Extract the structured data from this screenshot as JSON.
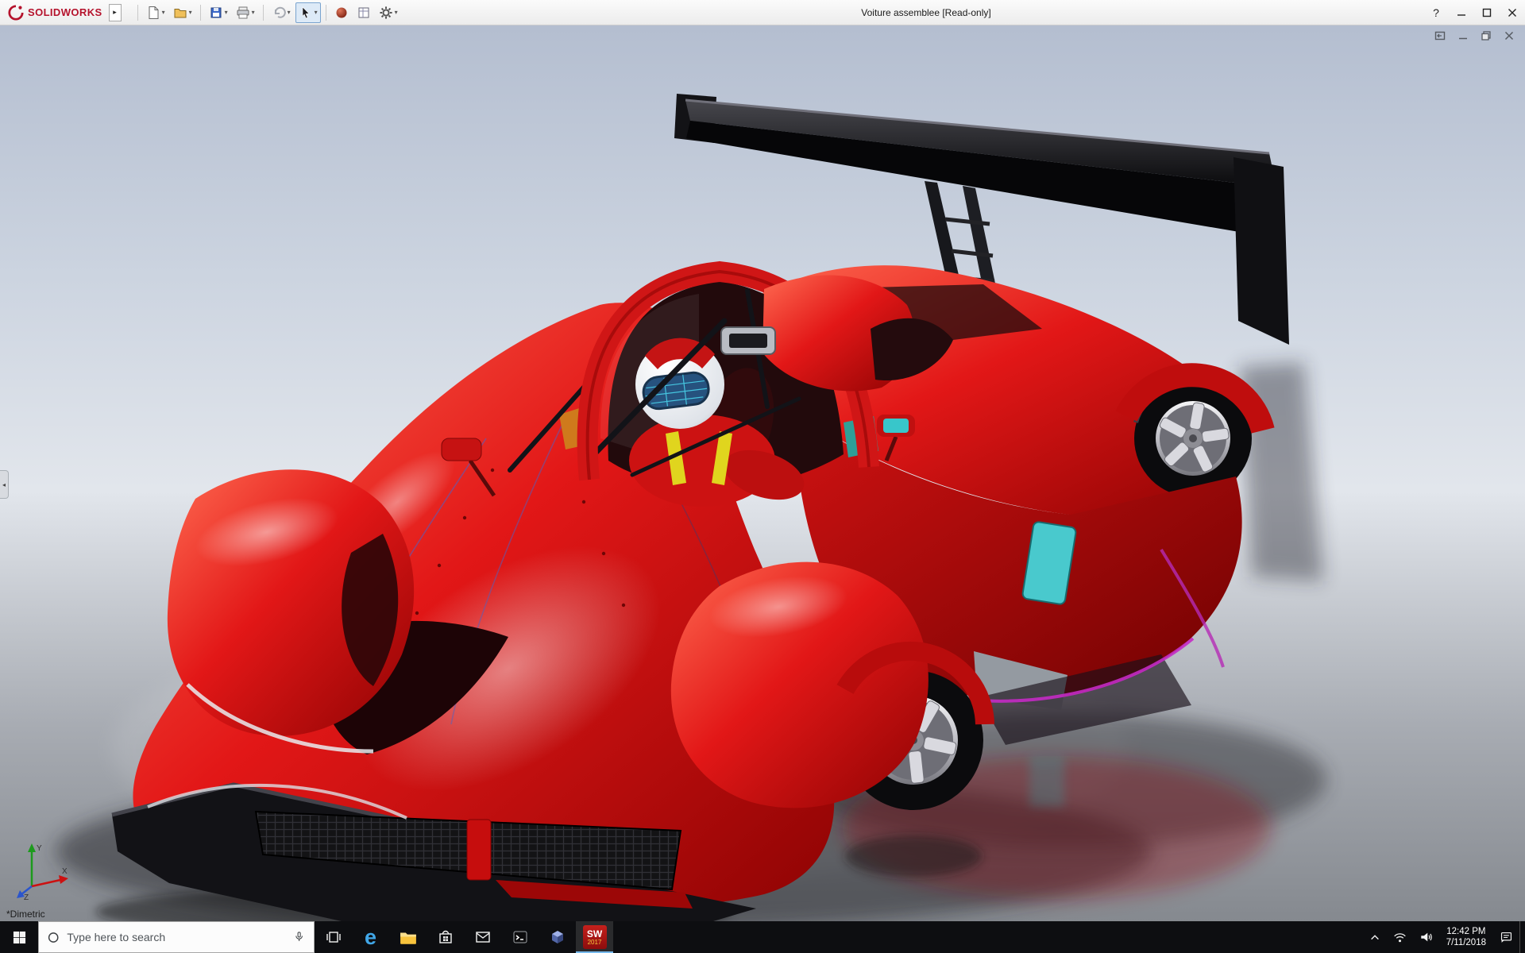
{
  "colors": {
    "titlebar_bg": "#f2f2f2",
    "taskbar_bg": "#0d0e11",
    "brand_red": "#b5122c",
    "car_red": "#e21717",
    "wing_black": "#0a0a0c",
    "viewport_sky": "#c7cfdd",
    "viewport_floor": "#85898f",
    "window_teal": "#49c9cd",
    "trim_magenta": "#c42ac4"
  },
  "window": {
    "brand": "SOLIDWORKS",
    "title": "Voiture assemblee [Read-only]",
    "help_label": "?"
  },
  "toolbar": {
    "items": [
      {
        "name": "new-document"
      },
      {
        "name": "open-document"
      },
      {
        "name": "save"
      },
      {
        "name": "print"
      },
      {
        "name": "undo"
      },
      {
        "name": "select-tool",
        "active": true
      },
      {
        "name": "appearance-sphere"
      },
      {
        "name": "sheet-properties"
      },
      {
        "name": "options-gear"
      }
    ]
  },
  "viewport": {
    "view_label": "*Dimetric",
    "triad": {
      "x_label": "X",
      "y_label": "Y",
      "z_label": "Z"
    },
    "scene_description": "red prototype race car assembly with driver, rear wing and open wheels on reflective floor"
  },
  "taskbar": {
    "search": {
      "placeholder": "Type here to search"
    },
    "apps": [
      {
        "name": "task-view"
      },
      {
        "name": "edge"
      },
      {
        "name": "file-explorer"
      },
      {
        "name": "store"
      },
      {
        "name": "mail"
      },
      {
        "name": "command-prompt"
      },
      {
        "name": "cube-app"
      },
      {
        "name": "solidworks-2017",
        "active": true
      }
    ],
    "solidworks_tile": {
      "line1": "SW",
      "line2": "2017"
    },
    "tray": {
      "time": "12:42 PM",
      "date": "7/11/2018"
    }
  }
}
